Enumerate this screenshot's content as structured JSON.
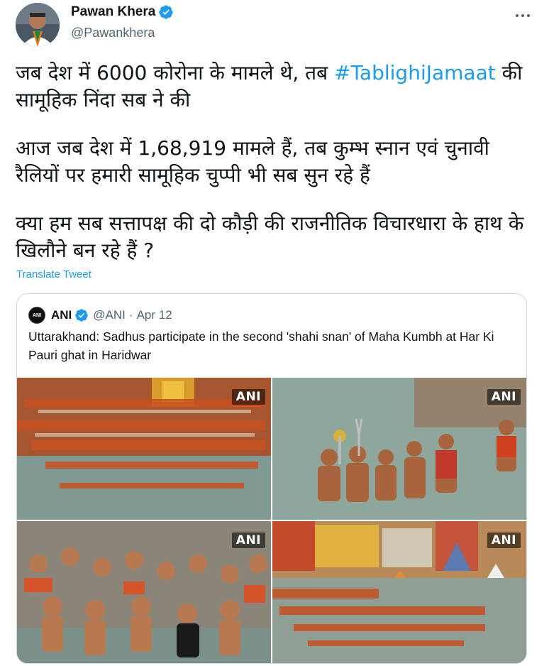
{
  "author": {
    "name": "Pawan Khera",
    "handle": "@Pawankhera"
  },
  "tweet": {
    "para1_before": "जब देश में 6000 कोरोना के मामले थे, तब ",
    "hashtag": "#TablighiJamaat",
    "para1_after": " की सामूहिक निंदा सब ने की",
    "para2": "आज जब देश में 1,68,919 मामले हैं, तब कुम्भ स्नान एवं चुनावी रैलियों पर हमारी सामूहिक चुप्पी भी सब सुन रहे हैं",
    "para3": "क्या हम सब सत्तापक्ष की दो कौड़ी की राजनीतिक विचारधारा के हाथ के खिलौने बन रहे हैं ?",
    "translate_label": "Translate Tweet"
  },
  "quote": {
    "logo_text": "ANI",
    "name": "ANI",
    "handle": "@ANI",
    "separator": "·",
    "date": "Apr 12",
    "text": "Uttarakhand: Sadhus participate in the second 'shahi snan' of Maha Kumbh at Har Ki Pauri ghat in Haridwar",
    "photos": [
      {
        "watermark": "ANI"
      },
      {
        "watermark": "ANI"
      },
      {
        "watermark": "ANI"
      },
      {
        "watermark": "ANI"
      }
    ]
  },
  "icons": {
    "verified": "verified-badge-icon",
    "more": "more-options-icon"
  },
  "colors": {
    "accent": "#1d9bf0",
    "text": "#0f1419",
    "secondary": "#536471",
    "border": "#cfd9de"
  }
}
